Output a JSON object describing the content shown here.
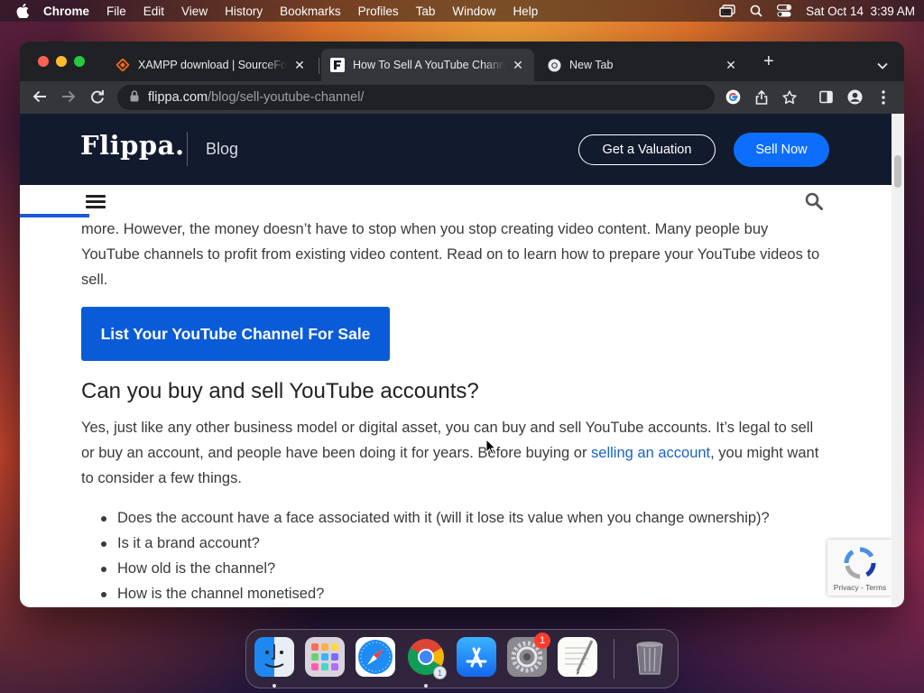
{
  "menubar": {
    "app": "Chrome",
    "items": [
      "File",
      "Edit",
      "View",
      "History",
      "Bookmarks",
      "Profiles",
      "Tab",
      "Window",
      "Help"
    ],
    "clock": "Sat Oct 14  3:39 AM"
  },
  "browser": {
    "tabs": [
      {
        "title": "XAMPP download | SourceForge",
        "favicon": "sourceforge-icon"
      },
      {
        "title": "How To Sell A YouTube Channel",
        "favicon": "flippa-icon"
      },
      {
        "title": "New Tab",
        "favicon": "chrome-icon"
      }
    ],
    "active_tab": 1,
    "url_host": "flippa.com",
    "url_path": "/blog/sell-youtube-channel/"
  },
  "site": {
    "logo": "Flippa.",
    "section": "Blog",
    "valuation_button": "Get a Valuation",
    "sell_button": "Sell Now",
    "reading_progress": 0.08
  },
  "article": {
    "intro": "more. However, the money doesn’t have to stop when you stop creating video content. Many people buy YouTube channels to profit from existing video content. Read on to learn how to prepare your YouTube videos to sell.",
    "cta_button": "List Your YouTube Channel For Sale",
    "heading": "Can you buy and sell YouTube accounts?",
    "para_before_link": "Yes, just like any other business model or digital asset, you can buy and sell YouTube accounts. It’s legal to sell or buy an account, and people have been doing it for years. Before buying or ",
    "para_link": "selling an account",
    "para_after_link": ", you might want to consider a few things.",
    "bullets": [
      "Does the account have a face associated with it (will it lose its value when you change ownership)?",
      "Is it a brand account?",
      "How old is the channel?",
      "How is the channel monetised?"
    ]
  },
  "recaptcha": {
    "terms": "Privacy - Terms"
  },
  "dock": {
    "apps": [
      "finder",
      "launchpad",
      "safari",
      "chrome",
      "app-store",
      "system-settings",
      "textedit",
      "trash"
    ],
    "settings_badge": "1",
    "chrome_badge": "1"
  }
}
